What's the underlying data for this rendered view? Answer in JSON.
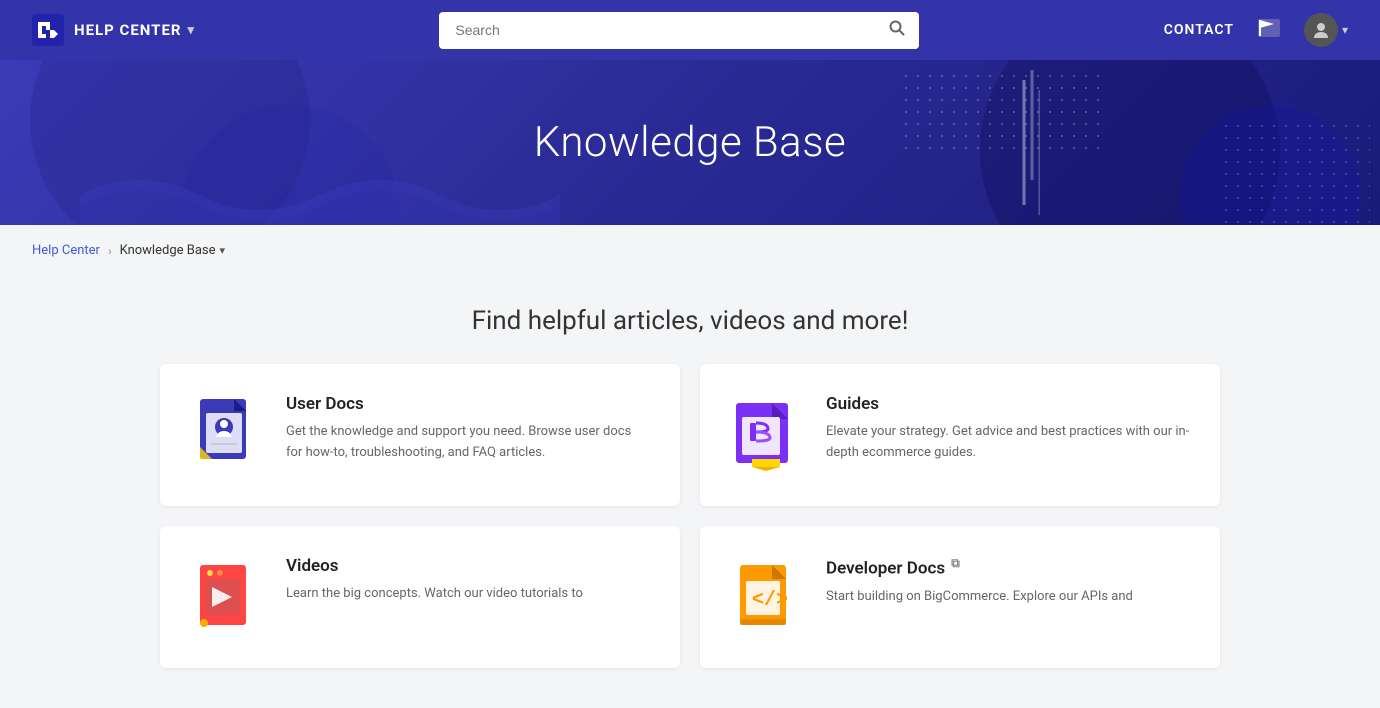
{
  "navbar": {
    "brand_logo_alt": "BigCommerce logo",
    "brand_text": "HELP CENTER",
    "brand_dropdown": "▾",
    "search_placeholder": "Search",
    "contact_label": "CONTACT",
    "flag_icon": "🏳",
    "avatar_icon": "👤",
    "avatar_dropdown": "▾"
  },
  "hero": {
    "title": "Knowledge Base"
  },
  "breadcrumb": {
    "home_label": "Help Center",
    "separator": "›",
    "current_label": "Knowledge Base",
    "dropdown_icon": "▾"
  },
  "main": {
    "section_title": "Find helpful articles, videos and more!",
    "cards": [
      {
        "id": "user-docs",
        "title": "User Docs",
        "description": "Get the knowledge and support you need. Browse user docs for how-to, troubleshooting, and FAQ articles.",
        "external": false
      },
      {
        "id": "guides",
        "title": "Guides",
        "description": "Elevate your strategy. Get advice and best practices with our in-depth ecommerce guides.",
        "external": false
      },
      {
        "id": "videos",
        "title": "Videos",
        "description": "Learn the big concepts. Watch our video tutorials to",
        "external": false
      },
      {
        "id": "developer-docs",
        "title": "Developer Docs",
        "description": "Start building on BigCommerce. Explore our APIs and",
        "external": true
      }
    ]
  }
}
